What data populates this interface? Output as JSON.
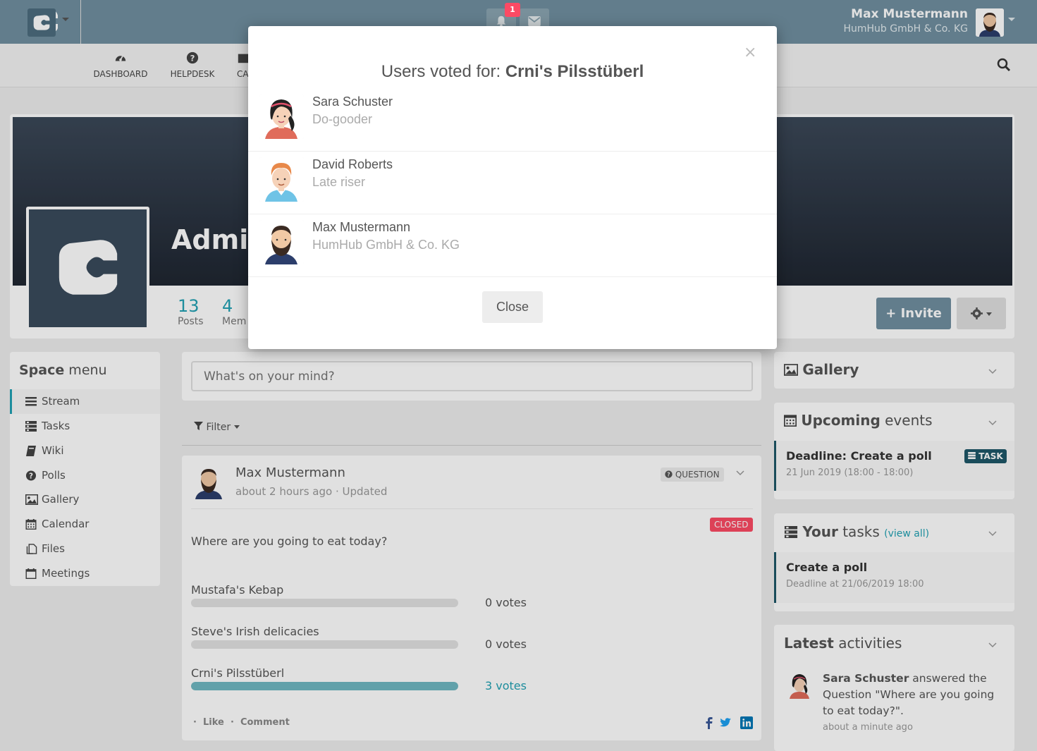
{
  "topbar": {
    "notification_count": "1",
    "user_name": "Max Mustermann",
    "user_org": "HumHub GmbH & Co. KG"
  },
  "subnav": {
    "items": [
      {
        "label": "DASHBOARD",
        "icon": "dashboard-icon"
      },
      {
        "label": "HELPDESK",
        "icon": "question-circle-icon"
      },
      {
        "label": "CA",
        "icon": "calendar-icon"
      }
    ]
  },
  "space": {
    "title": "Admin",
    "stats": [
      {
        "value": "13",
        "label": "Posts"
      },
      {
        "value": "4",
        "label": "Mem"
      }
    ],
    "invite_label": "Invite"
  },
  "space_menu": {
    "title_bold": "Space",
    "title_rest": " menu",
    "items": [
      {
        "label": "Stream",
        "icon": "list-icon"
      },
      {
        "label": "Tasks",
        "icon": "tasks-icon"
      },
      {
        "label": "Wiki",
        "icon": "book-icon"
      },
      {
        "label": "Polls",
        "icon": "question-circle-icon"
      },
      {
        "label": "Gallery",
        "icon": "image-icon"
      },
      {
        "label": "Calendar",
        "icon": "calendar-icon"
      },
      {
        "label": "Files",
        "icon": "files-icon"
      },
      {
        "label": "Meetings",
        "icon": "calendar-blank-icon"
      }
    ]
  },
  "stream": {
    "post_placeholder": "What's on your mind?",
    "filter_label": "Filter",
    "post": {
      "author": "Max Mustermann",
      "meta": "about 2 hours ago · Updated",
      "badge": "QUESTION",
      "status": "CLOSED",
      "question": "Where are you going to eat today?",
      "answers": [
        {
          "label": "Mustafa's Kebap",
          "votes": "0 votes",
          "share": 0
        },
        {
          "label": "Steve's Irish delicacies",
          "votes": "0 votes",
          "share": 0
        },
        {
          "label": "Crni's Pilsstüberl",
          "votes": "3 votes",
          "share": 1
        }
      ],
      "like_label": "Like",
      "comment_label": "Comment"
    }
  },
  "sidebar": {
    "gallery_title": "Gallery",
    "events_title_bold": "Upcoming",
    "events_title_rest": " events",
    "event": {
      "title": "Deadline: Create a poll",
      "date": "21 Jun 2019 (18:00 - 18:00)",
      "badge": "TASK"
    },
    "tasks_title_bold": "Your",
    "tasks_title_rest": " tasks",
    "tasks_view_all": "(view all)",
    "task": {
      "title": "Create a poll",
      "deadline": "Deadline at 21/06/2019 18:00"
    },
    "activities_title_bold": "Latest",
    "activities_title_rest": " activities",
    "activity": {
      "actor": "Sara Schuster",
      "text": " answered the Question \"Where are you going to eat today?\".",
      "time": "about a minute ago"
    }
  },
  "modal": {
    "title_prefix": "Users voted for: ",
    "title_option": "Crni's Pilsstüberl",
    "voters": [
      {
        "name": "Sara Schuster",
        "subtitle": "Do-gooder"
      },
      {
        "name": "David Roberts",
        "subtitle": "Late riser"
      },
      {
        "name": "Max Mustermann",
        "subtitle": "HumHub GmbH & Co. KG"
      }
    ],
    "close_x": "×",
    "close_label": "Close"
  },
  "colors": {
    "topbar": "#708fa0",
    "accent": "#21a1b3",
    "danger": "#fc4a64",
    "task_badge": "#1e5768"
  }
}
